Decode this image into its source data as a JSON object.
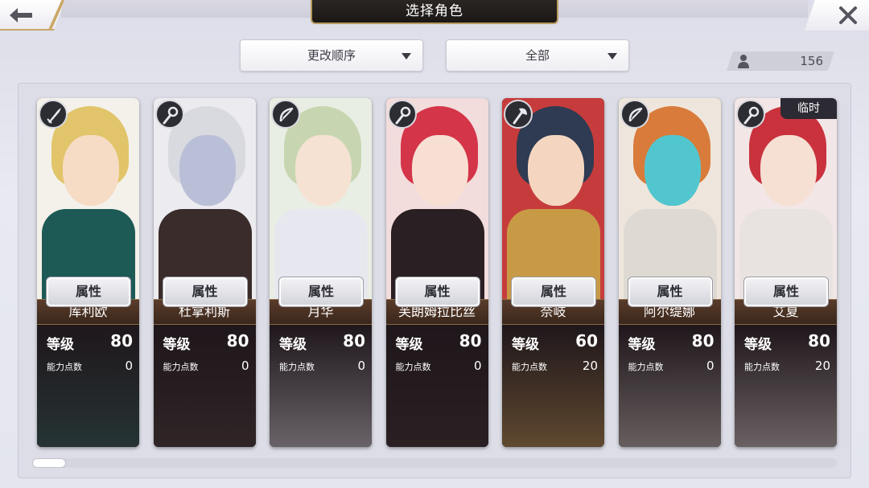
{
  "header": {
    "title": "选择角色"
  },
  "toolbar": {
    "sort_label": "更改顺序",
    "filter_label": "全部",
    "count": "156"
  },
  "labels": {
    "level": "等级",
    "points": "能力点数",
    "attribute": "属性",
    "temporary": "临时"
  },
  "characters": [
    {
      "name": "库利欧",
      "level": "80",
      "points": "0",
      "weapon": "sword-icon",
      "temporary": false,
      "colors": {
        "bg": "#f3f1ea",
        "hair": "#e2c46a",
        "skin": "#f6dcc4",
        "outfit": "#1d5a55"
      }
    },
    {
      "name": "杜拿利斯",
      "level": "80",
      "points": "0",
      "weapon": "staff-icon",
      "temporary": false,
      "colors": {
        "bg": "#ecebef",
        "hair": "#d9d9e0",
        "skin": "#b9bfd6",
        "outfit": "#3a2c2a"
      }
    },
    {
      "name": "月华",
      "level": "80",
      "points": "0",
      "weapon": "bow-icon",
      "temporary": false,
      "colors": {
        "bg": "#e9eee4",
        "hair": "#c7d6b0",
        "skin": "#f6e2d2",
        "outfit": "#e7e8ef"
      }
    },
    {
      "name": "芙朗姆拉比丝",
      "level": "80",
      "points": "0",
      "weapon": "staff-icon",
      "temporary": false,
      "colors": {
        "bg": "#f2dcdc",
        "hair": "#d43549",
        "skin": "#f7e0d3",
        "outfit": "#2a1f22"
      }
    },
    {
      "name": "奈岐",
      "level": "60",
      "points": "20",
      "weapon": "axe-icon",
      "temporary": false,
      "colors": {
        "bg": "#c63c3c",
        "hair": "#2e3b52",
        "skin": "#f4d6c0",
        "outfit": "#c99a45"
      }
    },
    {
      "name": "阿尔缇娜",
      "level": "80",
      "points": "0",
      "weapon": "bow-icon",
      "temporary": false,
      "colors": {
        "bg": "#eee6dc",
        "hair": "#d97b3a",
        "skin": "#52c6cf",
        "outfit": "#ded9d3"
      }
    },
    {
      "name": "艾夏",
      "level": "80",
      "points": "20",
      "weapon": "staff-icon",
      "temporary": true,
      "colors": {
        "bg": "#f3e6e6",
        "hair": "#c9323d",
        "skin": "#f6e0d4",
        "outfit": "#e8e3e0"
      }
    }
  ]
}
